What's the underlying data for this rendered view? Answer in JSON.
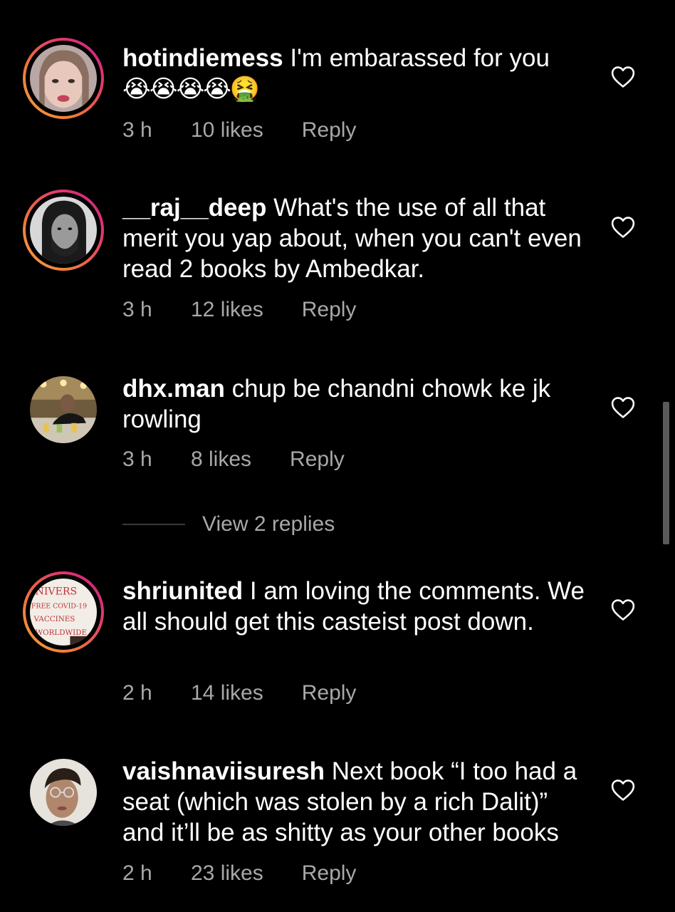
{
  "comments": [
    {
      "username": "hotindiemess",
      "text": "I'm embarassed for you",
      "emojis": "😭😭😭😭🤮",
      "time": "3 h",
      "likes": "10 likes",
      "reply": "Reply",
      "story_ring": true
    },
    {
      "username": "__raj__deep",
      "text": "What's the use of all that merit you yap about, when you can't even read 2 books by Ambedkar.",
      "time": "3 h",
      "likes": "12 likes",
      "reply": "Reply",
      "story_ring": true
    },
    {
      "username": "dhx.man",
      "text": "chup be chandni chowk ke jk rowling",
      "time": "3 h",
      "likes": "8 likes",
      "reply": "Reply",
      "story_ring": false
    },
    {
      "username": "shriunited",
      "text": "I am loving the comments. We all should get this casteist post down.",
      "time": "2 h",
      "likes": "14 likes",
      "reply": "Reply",
      "story_ring": true,
      "avatar_sign": [
        "NIVERS",
        "FREE COVID-19",
        "VACCINES",
        "WORLDWIDE"
      ]
    },
    {
      "username": "vaishnaviisuresh",
      "text": "Next book “I too had a seat (which was stolen by a rich Dalit)” and it’ll be as shitty as your other books",
      "time": "2 h",
      "likes": "23 likes",
      "reply": "Reply",
      "story_ring": false
    }
  ],
  "view_replies": "View 2 replies",
  "icons": {
    "like": "heart-outline-icon"
  },
  "colors": {
    "background": "#000000",
    "text": "#ffffff",
    "secondary_text": "#a8a8a8",
    "story_ring_start": "#f7a340",
    "story_ring_end": "#c21f8a"
  }
}
